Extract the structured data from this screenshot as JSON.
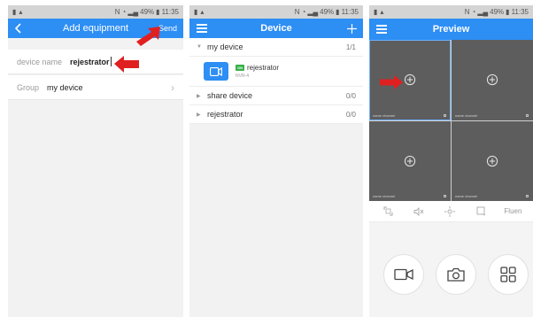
{
  "status": {
    "signal_text": "49%",
    "time": "11:35"
  },
  "add_equipment": {
    "title": "Add equipment",
    "send_label": "Send",
    "device_name_label": "device name",
    "device_name_value": "rejestrator",
    "group_label": "Group",
    "group_value": "my device"
  },
  "device": {
    "title": "Device",
    "groups": [
      {
        "name": "my device",
        "count": "1/1"
      },
      {
        "name": "share device",
        "count": "0/0"
      },
      {
        "name": "rejestrator",
        "count": "0/0"
      }
    ],
    "item": {
      "name": "rejestrator",
      "badge": "ON",
      "subtitle": "NVR-4"
    }
  },
  "preview": {
    "title": "Preview",
    "channel_label": "name channel",
    "toolbar_fluent": "Fluen"
  },
  "colors": {
    "accent": "#2d8ef4",
    "arrow": "#e02020"
  }
}
